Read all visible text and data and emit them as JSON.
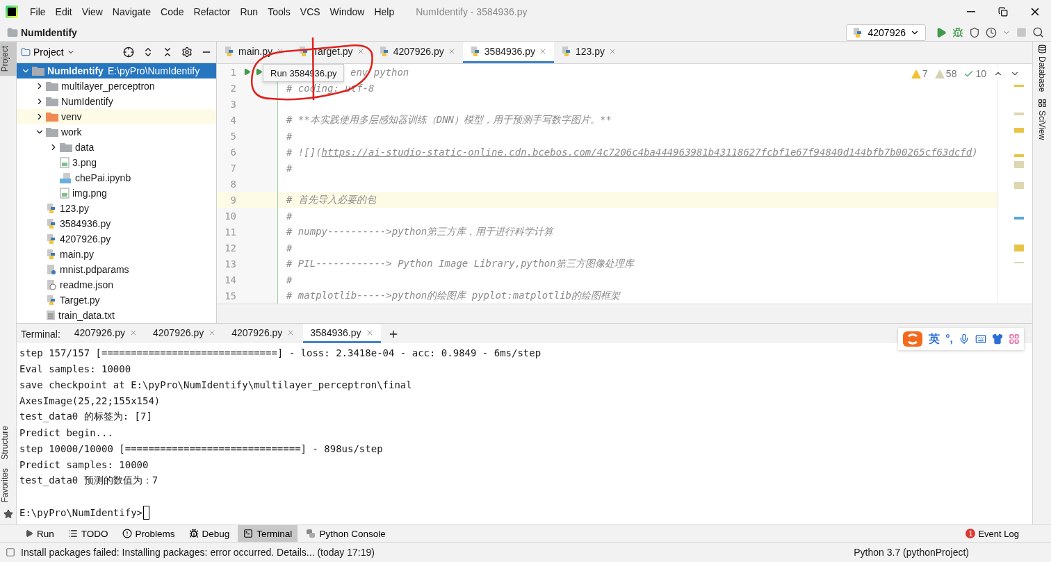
{
  "window": {
    "title": "NumIdentify - 3584936.py"
  },
  "menu": [
    "File",
    "Edit",
    "View",
    "Navigate",
    "Code",
    "Refactor",
    "Run",
    "Tools",
    "VCS",
    "Window",
    "Help"
  ],
  "breadcrumb": "NumIdentify",
  "run_config": {
    "label": "4207926"
  },
  "left_strip": {
    "top": [
      {
        "label": "Project",
        "selected": true
      }
    ],
    "bottom": [
      {
        "label": "Structure",
        "selected": false
      },
      {
        "label": "Favorites",
        "selected": false
      }
    ]
  },
  "right_strip": [
    {
      "label": "Database"
    },
    {
      "label": "SciView"
    }
  ],
  "project": {
    "title": "Project",
    "tree": [
      {
        "name": "NumIdentify",
        "path": "E:\\pyPro\\NumIdentify",
        "kind": "folder",
        "expanded": true,
        "selected": true,
        "highlighted": false,
        "children": [
          {
            "name": "multilayer_perceptron",
            "kind": "folder",
            "expanded": false,
            "selected": false,
            "highlighted": false
          },
          {
            "name": "NumIdentify",
            "kind": "folder",
            "expanded": false,
            "selected": false,
            "highlighted": false
          },
          {
            "name": "venv",
            "kind": "excluded-folder",
            "expanded": false,
            "selected": false,
            "highlighted": true
          },
          {
            "name": "work",
            "kind": "folder",
            "expanded": true,
            "selected": false,
            "highlighted": false,
            "children": [
              {
                "name": "data",
                "kind": "folder",
                "expanded": false,
                "selected": false,
                "highlighted": false
              },
              {
                "name": "3.png",
                "kind": "image",
                "selected": false,
                "highlighted": false
              },
              {
                "name": "chePai.ipynb",
                "kind": "notebook",
                "selected": false,
                "highlighted": false
              },
              {
                "name": "img.png",
                "kind": "image",
                "selected": false,
                "highlighted": false
              }
            ]
          },
          {
            "name": "123.py",
            "kind": "python",
            "selected": false,
            "highlighted": false
          },
          {
            "name": "3584936.py",
            "kind": "python",
            "selected": false,
            "highlighted": false
          },
          {
            "name": "4207926.py",
            "kind": "python",
            "selected": false,
            "highlighted": false
          },
          {
            "name": "main.py",
            "kind": "python",
            "selected": false,
            "highlighted": false
          },
          {
            "name": "mnist.pdparams",
            "kind": "unknown",
            "selected": false,
            "highlighted": false
          },
          {
            "name": "readme.json",
            "kind": "json",
            "selected": false,
            "highlighted": false
          },
          {
            "name": "Target.py",
            "kind": "python",
            "selected": false,
            "highlighted": false
          },
          {
            "name": "train_data.txt",
            "kind": "text",
            "selected": false,
            "highlighted": false
          }
        ]
      }
    ]
  },
  "editor": {
    "tabs": [
      {
        "label": "main.py",
        "selected": false
      },
      {
        "label": "Target.py",
        "selected": false
      },
      {
        "label": "4207926.py",
        "selected": false
      },
      {
        "label": "3584936.py",
        "selected": true
      },
      {
        "label": "123.py",
        "selected": false
      }
    ],
    "tooltip": "Run 3584936.py",
    "inspections": [
      {
        "kind": "warning",
        "count": "7"
      },
      {
        "kind": "weak-warning",
        "count": "58"
      },
      {
        "kind": "typo",
        "count": "10"
      }
    ],
    "lines": [
      {
        "number": "1",
        "text": "env python",
        "highlighted": false
      },
      {
        "number": "2",
        "text": "# coding: utf-8",
        "highlighted": false
      },
      {
        "number": "3",
        "highlighted": false
      },
      {
        "number": "4",
        "text": "# **本实践使用多层感知器训练（DNN）模型，用于预测手写数字图片。**",
        "highlighted": false
      },
      {
        "number": "5",
        "text": "#",
        "highlighted": false
      },
      {
        "number": "6",
        "text": "# ![](",
        "link": "https://ai-studio-static-online.cdn.bcebos.com/4c7206c4ba444963981b43118627fcbf1e67f94840d144bfb7b00265cf63dcfd",
        "suffix": ")",
        "highlighted": false
      },
      {
        "number": "7",
        "text": "#",
        "highlighted": false
      },
      {
        "number": "8",
        "highlighted": false
      },
      {
        "number": "9",
        "text": "# 首先导入必要的包",
        "highlighted": true
      },
      {
        "number": "10",
        "text": "#",
        "highlighted": false
      },
      {
        "number": "11",
        "text": "# numpy---------->python第三方库，用于进行科学计算",
        "highlighted": false
      },
      {
        "number": "12",
        "text": "#",
        "highlighted": false
      },
      {
        "number": "13",
        "text": "# PIL------------> Python Image Library,python第三方图像处理库",
        "highlighted": false
      },
      {
        "number": "14",
        "text": "#",
        "highlighted": false
      },
      {
        "number": "15",
        "text": "# matplotlib----->python的绘图库 pyplot:matplotlib的绘图框架",
        "highlighted": false
      }
    ]
  },
  "terminal": {
    "label": "Terminal:",
    "tabs": [
      {
        "label": "4207926.py",
        "selected": false
      },
      {
        "label": "4207926.py",
        "selected": false
      },
      {
        "label": "4207926.py",
        "selected": false
      },
      {
        "label": "3584936.py",
        "selected": true
      }
    ],
    "lines": [
      "step 157/157 [==============================] - loss: 2.3418e-04 - acc: 0.9849 - 6ms/step",
      "Eval samples: 10000",
      "save checkpoint at E:\\pyPro\\NumIdentify\\multilayer_perceptron\\final",
      "AxesImage(25,22;155x154)",
      "test_data0 的标签为: [7]",
      "Predict begin...",
      "step 10000/10000 [==============================] - 898us/step",
      "Predict samples: 10000",
      "test_data0 预测的数值为：7"
    ],
    "prompt": "E:\\pyPro\\NumIdentify>"
  },
  "ime": {
    "mode": "英",
    "punctuation": "°,"
  },
  "tool_buttons": [
    {
      "label": "Run",
      "kind": "run",
      "selected": false
    },
    {
      "label": "TODO",
      "kind": "todo",
      "selected": false
    },
    {
      "label": "Problems",
      "kind": "problems",
      "selected": false
    },
    {
      "label": "Debug",
      "kind": "debug",
      "selected": false
    },
    {
      "label": "Terminal",
      "kind": "terminal",
      "selected": true
    },
    {
      "label": "Python Console",
      "kind": "console",
      "selected": false
    }
  ],
  "event_log": {
    "label": "Event Log",
    "count": "1"
  },
  "status": {
    "message": "Install packages failed: Installing packages: error occurred. Details... (today 17:19)",
    "interpreter": "Python 3.7 (pythonProject)"
  }
}
